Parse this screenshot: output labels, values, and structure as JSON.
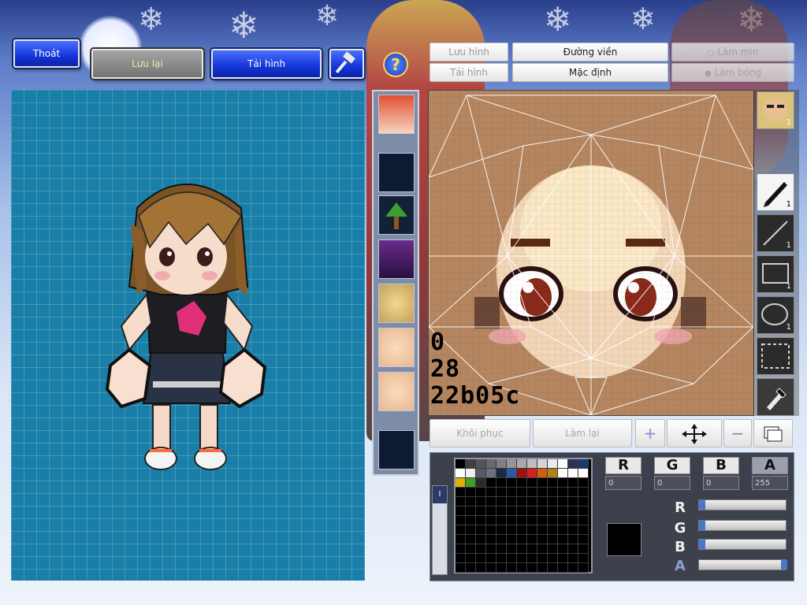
{
  "toolbar": {
    "exit_label": "Thoát",
    "save_label": "Lưu lại",
    "reload_label": "Tải hình"
  },
  "editor_tabs": {
    "save_image": "Lưu hình",
    "border": "Đường viền",
    "smooth": "Làm mịn",
    "load_image": "Tải hình",
    "default": "Mặc định",
    "shine": "Làm bóng"
  },
  "readout": {
    "line1": "0",
    "line2": "28",
    "line3": "22b05c"
  },
  "tools": {
    "avatar_count": "1",
    "pen_size": "1",
    "line_size": "1",
    "rect_size": "1",
    "ellipse_size": "1"
  },
  "bottom_buttons": {
    "restore": "Khôi phục",
    "redo": "Làm lại"
  },
  "channels": {
    "r_label": "R",
    "g_label": "G",
    "b_label": "B",
    "a_label": "A",
    "r_value": "0",
    "g_value": "0",
    "b_value": "0",
    "a_value": "255",
    "r_level": 0,
    "g_level": 0,
    "b_level": 0,
    "a_level": 1.0
  },
  "palette": {
    "row1": [
      "#000000",
      "#404040",
      "#555555",
      "#6a6a6a",
      "#808080",
      "#959595",
      "#aaaaaa",
      "#bfbfbf",
      "#d4d4d4",
      "#eaeaea",
      "#ffffff",
      "#2a3550",
      "#1a3a70",
      "#c0c0c0"
    ],
    "row2": [
      "#ffffff",
      "#f0f0f0",
      "#555a66",
      "#6d7280",
      "#1e2a44",
      "#2a5aa8",
      "#a01010",
      "#d02020",
      "#d06010",
      "#b08020",
      "#ffffff",
      "#ffffff",
      "#ffffff",
      "#ffffff"
    ],
    "row3": [
      "#e0b000",
      "#40a020",
      "#2a2a2a"
    ],
    "current_color": "#000000"
  }
}
